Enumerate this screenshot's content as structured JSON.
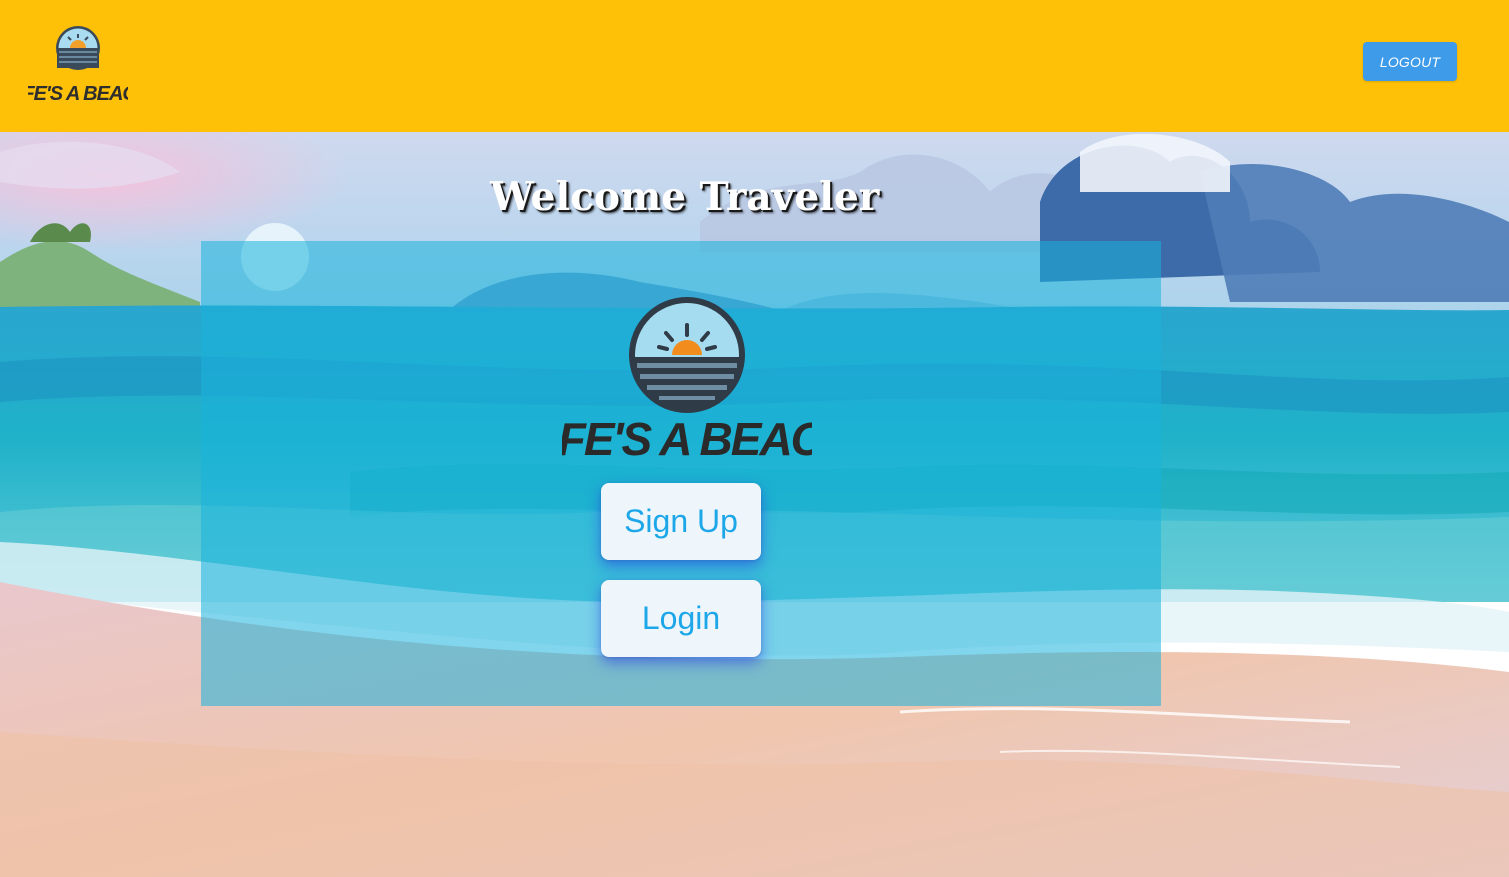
{
  "header": {
    "brand_text": "LIFE'S A BEACH",
    "logout_label": "LOGOUT",
    "background_color": "#ffc107",
    "logout_color": "#3d9be9"
  },
  "main": {
    "title": "Welcome Traveler",
    "card": {
      "logo_text": "LIFE'S A BEACH",
      "signup_label": "Sign Up",
      "login_label": "Login",
      "button_text_color": "#1ea7e8"
    }
  },
  "icons": {
    "brand_logo": "sunset-over-sea-logo",
    "card_logo": "sunset-over-sea-logo"
  }
}
